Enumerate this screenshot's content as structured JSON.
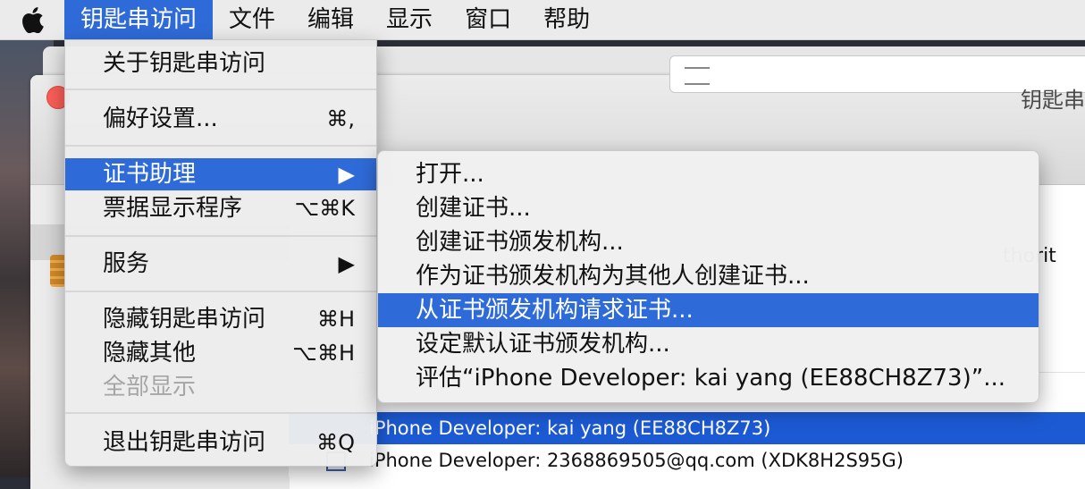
{
  "menubar": {
    "apple_icon": "apple-icon",
    "items": [
      "钥匙串访问",
      "文件",
      "编辑",
      "显示",
      "窗口",
      "帮助"
    ]
  },
  "window": {
    "title": "钥匙串",
    "partial_text": "thorit",
    "rows": [
      "iPhone Developer: kai yang (EE88CH8Z73)",
      "iPhone Developer: 2368869505@qq.com (XDK8H2S95G)"
    ]
  },
  "app_menu": {
    "about": "关于钥匙串访问",
    "preferences": "偏好设置...",
    "preferences_shortcut": "⌘,",
    "cert_assistant": "证书助理",
    "cert_assistant_arrow": "▶",
    "ticket_viewer": "票据显示程序",
    "ticket_viewer_shortcut": "⌥⌘K",
    "services": "服务",
    "services_arrow": "▶",
    "hide": "隐藏钥匙串访问",
    "hide_shortcut": "⌘H",
    "hide_others": "隐藏其他",
    "hide_others_shortcut": "⌥⌘H",
    "show_all": "全部显示",
    "quit": "退出钥匙串访问",
    "quit_shortcut": "⌘Q"
  },
  "submenu": {
    "items": [
      "打开...",
      "创建证书...",
      "创建证书颁发机构...",
      "作为证书颁发机构为其他人创建证书...",
      "从证书颁发机构请求证书...",
      "设定默认证书颁发机构...",
      "评估“iPhone Developer: kai yang (EE88CH8Z73)”..."
    ],
    "highlighted_index": 4
  },
  "colors": {
    "menu_highlight": "#2f6bd8",
    "selection_row": "#1c5ad4",
    "close_button": "#fc5f57"
  }
}
